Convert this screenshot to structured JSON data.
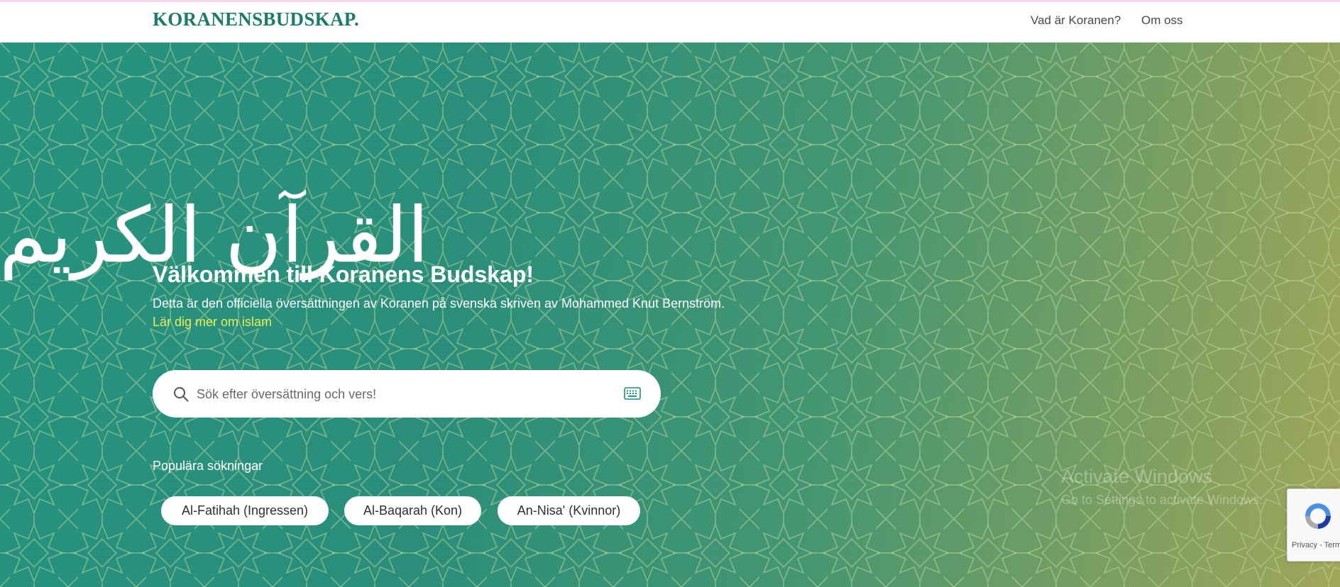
{
  "browser_accent": "#f3d6f1",
  "navbar": {
    "logo_text": "KORANENSBUDSKAP.",
    "links": [
      "Vad är Koranen?",
      "Om oss"
    ]
  },
  "hero": {
    "arabic_title": "القرآن الكريم",
    "welcome": "Välkommen till Koranens Budskap!",
    "subtitle": "Detta är den officiella översättningen av Koranen på svenska skriven av Mohammed Knut Bernström.",
    "learn_link": "Lär dig mer om islam"
  },
  "search": {
    "placeholder": "Sök efter översättning och vers!",
    "value": "",
    "search_icon": "search-icon",
    "keyboard_icon": "keyboard-icon"
  },
  "popular": {
    "label": "Populära sökningar",
    "items": [
      "Al-Fatihah (Ingressen)",
      "Al-Baqarah (Kon)",
      "An-Nisa' (Kvinnor)"
    ]
  },
  "windows_watermark": {
    "title": "Activate Windows",
    "subtitle": "Go to Settings to activate Windows."
  },
  "recaptcha": {
    "text": "Privacy - Terms"
  },
  "colors": {
    "brand": "#1a7d6a",
    "hero_start": "#1f8f7c",
    "hero_end": "#9aa357",
    "link_yellow": "#e9ee55"
  }
}
